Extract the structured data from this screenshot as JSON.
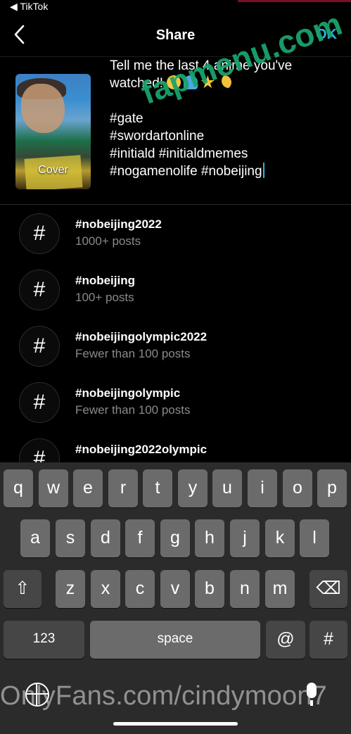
{
  "status_bar": {
    "back_app": "◀ TikTok"
  },
  "header": {
    "title": "Share",
    "ok_label": "OK"
  },
  "cover": {
    "label": "Cover"
  },
  "caption": {
    "lines": [
      "Tell me the last 4 anime you've",
      "watched!",
      "",
      "#gate",
      "#swordartonline",
      "#initiald #initialdmemes",
      "#nogamenolife #nobeijing"
    ],
    "emojis": [
      "laughing-face",
      "blue-heart",
      "star",
      "crescent-moon"
    ]
  },
  "watermarks": {
    "top": "fapmenu.com",
    "bottom": "OnlyFans.com/cindymoon7"
  },
  "suggestions": [
    {
      "tag": "#nobeijing2022",
      "count": "1000+ posts"
    },
    {
      "tag": "#nobeijing",
      "count": "100+ posts"
    },
    {
      "tag": "#nobeijingolympic2022",
      "count": "Fewer than 100 posts"
    },
    {
      "tag": "#nobeijingolympic",
      "count": "Fewer than 100 posts"
    },
    {
      "tag": "#nobeijing2022olympic",
      "count": ""
    }
  ],
  "keyboard": {
    "row1": [
      "q",
      "w",
      "e",
      "r",
      "t",
      "y",
      "u",
      "i",
      "o",
      "p"
    ],
    "row2": [
      "a",
      "s",
      "d",
      "f",
      "g",
      "h",
      "j",
      "k",
      "l"
    ],
    "row3": [
      "z",
      "x",
      "c",
      "v",
      "b",
      "n",
      "m"
    ],
    "numbers_label": "123",
    "space_label": "space",
    "at_label": "@",
    "hash_label": "#",
    "shift_glyph": "⇧",
    "delete_glyph": "⌫"
  },
  "colors": {
    "accent": "#2fb3e8",
    "watermark": "#1aa36c"
  }
}
